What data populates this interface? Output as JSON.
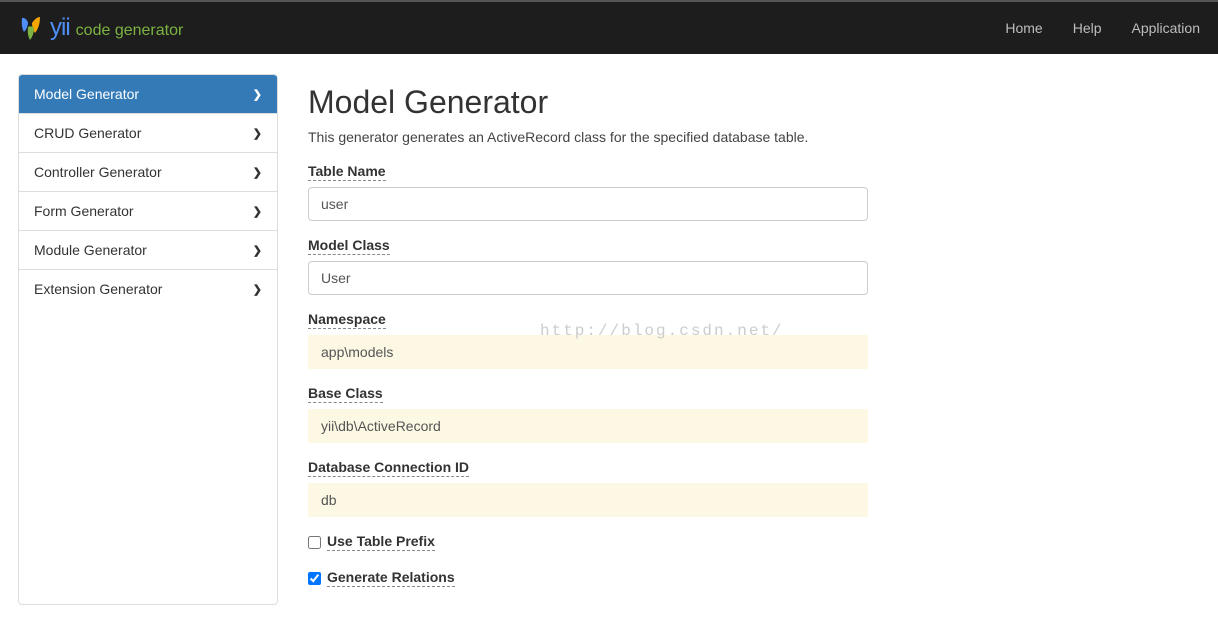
{
  "brand": {
    "name": "yii",
    "subtitle": "code generator"
  },
  "nav": {
    "items": [
      {
        "label": "Home"
      },
      {
        "label": "Help"
      },
      {
        "label": "Application"
      }
    ]
  },
  "sidebar": {
    "items": [
      {
        "label": "Model Generator",
        "active": true
      },
      {
        "label": "CRUD Generator",
        "active": false
      },
      {
        "label": "Controller Generator",
        "active": false
      },
      {
        "label": "Form Generator",
        "active": false
      },
      {
        "label": "Module Generator",
        "active": false
      },
      {
        "label": "Extension Generator",
        "active": false
      }
    ]
  },
  "page": {
    "title": "Model Generator",
    "description": "This generator generates an ActiveRecord class for the specified database table."
  },
  "form": {
    "tableName": {
      "label": "Table Name",
      "value": "user"
    },
    "modelClass": {
      "label": "Model Class",
      "value": "User"
    },
    "namespace": {
      "label": "Namespace",
      "value": "app\\models"
    },
    "baseClass": {
      "label": "Base Class",
      "value": "yii\\db\\ActiveRecord"
    },
    "dbConnection": {
      "label": "Database Connection ID",
      "value": "db"
    },
    "useTablePrefix": {
      "label": "Use Table Prefix",
      "checked": false
    },
    "generateRelations": {
      "label": "Generate Relations",
      "checked": true
    }
  },
  "watermark": "http://blog.csdn.net/"
}
